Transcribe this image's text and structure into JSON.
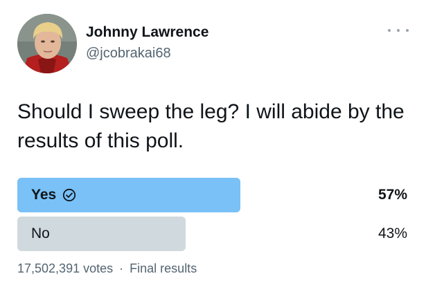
{
  "author": {
    "name": "Johnny Lawrence",
    "handle": "@jcobrakai68"
  },
  "tweet": {
    "text": "Should I sweep the leg? I will abide by the results of this poll."
  },
  "poll": {
    "options": [
      {
        "label": "Yes",
        "percent_label": "57%",
        "fraction": 0.57,
        "winner": true,
        "icon": "check-circle-icon"
      },
      {
        "label": "No",
        "percent_label": "43%",
        "fraction": 0.43,
        "winner": false
      }
    ],
    "votes": "17,502,391 votes",
    "separator": "·",
    "status": "Final results"
  },
  "colors": {
    "winner_bar": "#79c1f6",
    "other_bar": "#cfd9de",
    "secondary_text": "#536471"
  }
}
